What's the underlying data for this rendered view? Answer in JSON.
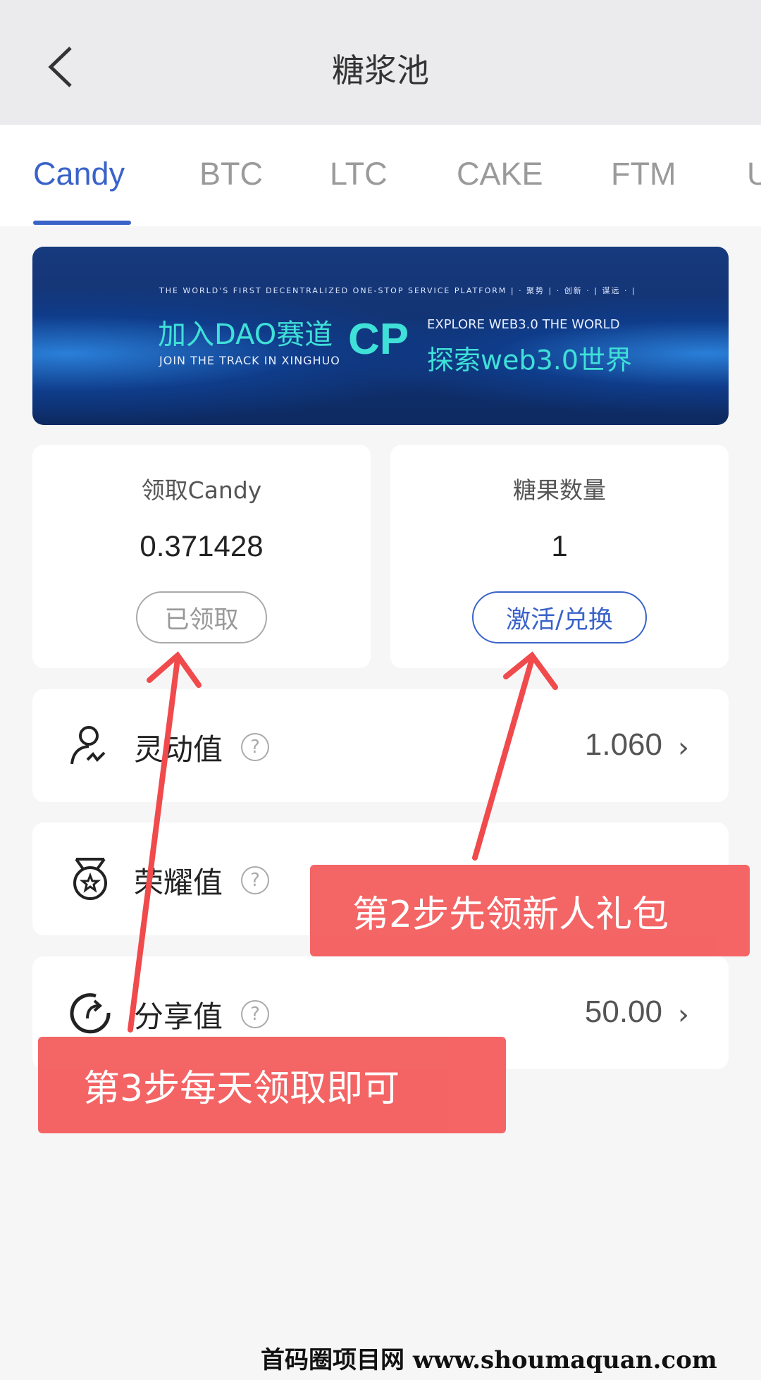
{
  "header": {
    "title": "糖浆池",
    "back_icon": "chevron-left-icon"
  },
  "tabs": [
    {
      "label": "Candy",
      "active": true
    },
    {
      "label": "BTC"
    },
    {
      "label": "LTC"
    },
    {
      "label": "CAKE"
    },
    {
      "label": "FTM"
    },
    {
      "label": "U"
    }
  ],
  "banner": {
    "tagline": "THE WORLD'S FIRST DECENTRALIZED ONE-STOP SERVICE PLATFORM | · 聚势 | · 创新 · | 谋远 · |",
    "cn1": "加入DAO赛道",
    "en1": "JOIN THE TRACK IN XINGHUO",
    "logo": "CP",
    "en2": "EXPLORE WEB3.0 THE WORLD",
    "cn2": "探索web3.0世界"
  },
  "cards": [
    {
      "label": "领取Candy",
      "value": "0.371428",
      "button": "已领取"
    },
    {
      "label": "糖果数量",
      "value": "1",
      "button": "激活/兑换"
    }
  ],
  "rows": [
    {
      "label": "灵动值",
      "value": "1.060",
      "icon": "user-activity-icon"
    },
    {
      "label": "荣耀值",
      "value": "",
      "icon": "medal-icon"
    },
    {
      "label": "分享值",
      "value": "50.00",
      "icon": "share-refresh-icon"
    }
  ],
  "help_symbol": "?",
  "chevron": "›",
  "annotations": {
    "step2": "第2步先领新人礼包",
    "step3": "第3步每天领取即可"
  },
  "footer": {
    "watermark": "首码圈项目网 www.shoumaquan.com"
  },
  "colors": {
    "accent": "#3a63c9",
    "annotation": "#f45d5e"
  }
}
